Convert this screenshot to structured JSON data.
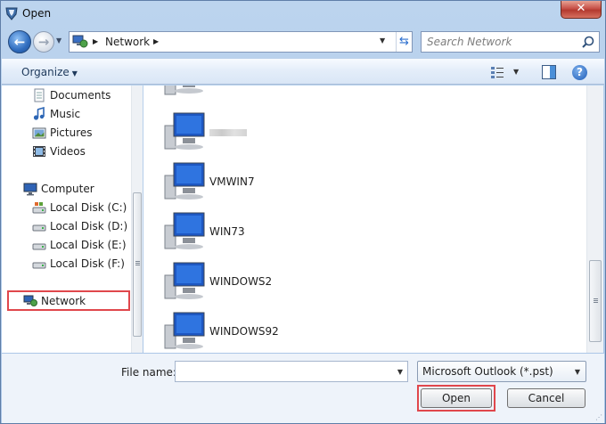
{
  "window": {
    "title": "Open"
  },
  "address": {
    "location": "Network"
  },
  "search": {
    "placeholder": "Search Network"
  },
  "toolbar": {
    "organize_label": "Organize"
  },
  "nav": {
    "items": [
      {
        "label": "Documents",
        "icon": "documents-icon"
      },
      {
        "label": "Music",
        "icon": "music-icon"
      },
      {
        "label": "Pictures",
        "icon": "pictures-icon"
      },
      {
        "label": "Videos",
        "icon": "videos-icon"
      },
      {
        "label": "Computer",
        "icon": "computer-icon"
      },
      {
        "label": "Local Disk (C:)",
        "icon": "drive-icon"
      },
      {
        "label": "Local Disk (D:)",
        "icon": "drive-icon"
      },
      {
        "label": "Local Disk (E:)",
        "icon": "drive-icon"
      },
      {
        "label": "Local Disk (F:)",
        "icon": "drive-icon"
      },
      {
        "label": "Network",
        "icon": "network-icon"
      }
    ]
  },
  "content": {
    "computers": [
      {
        "label": "VMWIN7"
      },
      {
        "label": "WIN73"
      },
      {
        "label": "WINDOWS2"
      },
      {
        "label": "WINDOWS92"
      }
    ]
  },
  "footer": {
    "file_name_label": "File name:",
    "file_name_value": "",
    "filter_value": "Microsoft Outlook (*.pst)",
    "open_label": "Open",
    "cancel_label": "Cancel"
  }
}
